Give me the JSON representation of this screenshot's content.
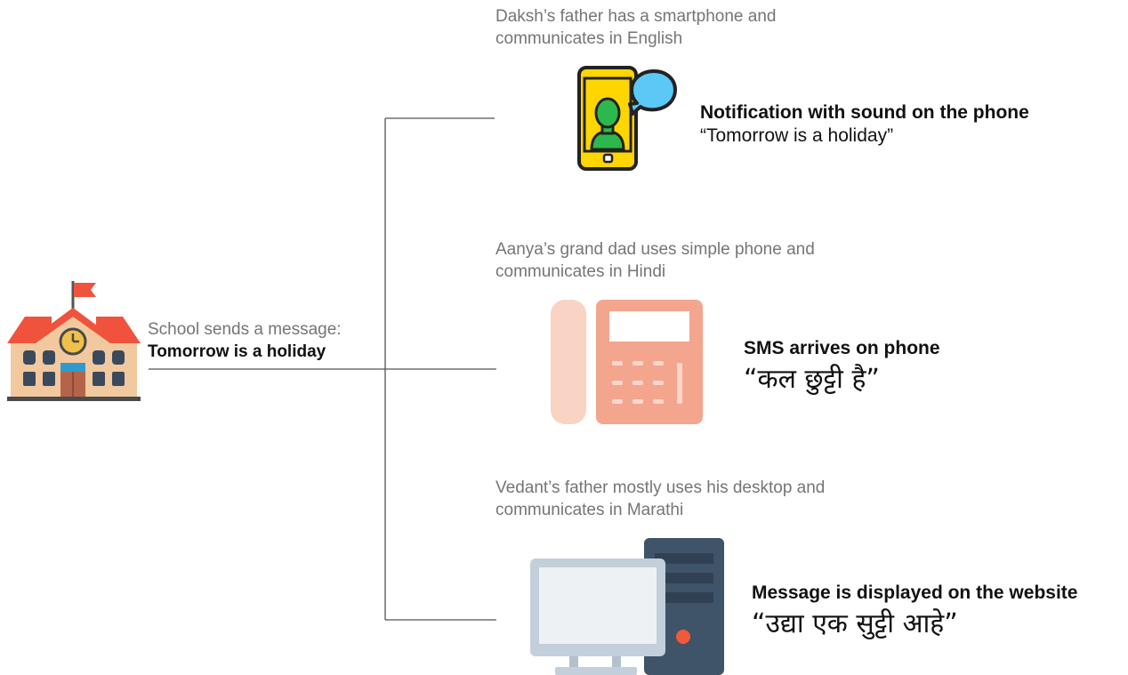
{
  "school": {
    "icon": "school-building-icon",
    "line1": "School sends a message:",
    "line2": "Tomorrow is a holiday"
  },
  "recipients": [
    {
      "note_line1": "Daksh’s father has a smartphone and",
      "note_line2": "communicates in English",
      "icon": "smartphone-chat-icon",
      "title": "Notification with sound on the phone",
      "message": "“Tomorrow is a holiday”"
    },
    {
      "note_line1": "Aanya’s grand dad uses simple phone and",
      "note_line2": "communicates in Hindi",
      "icon": "landline-phone-icon",
      "title": "SMS arrives on phone",
      "message": "“कल छुट्टी है”"
    },
    {
      "note_line1": "Vedant’s father mostly uses his desktop and",
      "note_line2": "communicates in Marathi",
      "icon": "desktop-computer-icon",
      "title": "Message is displayed on the website",
      "message": "“उद्या एक सुट्टी आहे”"
    }
  ],
  "colors": {
    "connector": "#555555",
    "phone_yellow": "#FFD600",
    "landline_pink": "#F4A58E",
    "desktop_slate": "#3F5468"
  }
}
